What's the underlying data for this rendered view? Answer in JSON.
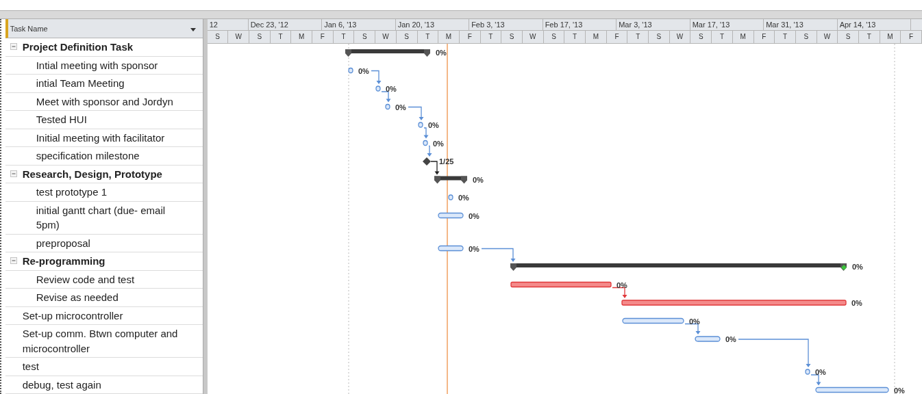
{
  "table": {
    "header": "Task Name",
    "rows": [
      {
        "name": "Project Definition Task",
        "expanded": true,
        "deadline": false,
        "bar": {
          "kind": "summary",
          "label": "0%"
        },
        "children": [
          {
            "name": "Intial meeting with sponsor",
            "deadline": false,
            "bar": {
              "kind": "task",
              "label": "0%"
            }
          },
          {
            "name": "intial Team Meeting",
            "deadline": false,
            "bar": {
              "kind": "task",
              "label": "0%"
            }
          },
          {
            "name": "Meet with sponsor and Jordyn",
            "deadline": false,
            "bar": {
              "kind": "task",
              "label": "0%"
            }
          },
          {
            "name": "Tested HUI",
            "deadline": false,
            "bar": {
              "kind": "task",
              "label": "0%"
            }
          },
          {
            "name": "Initial meeting with facilitator",
            "deadline": false,
            "bar": {
              "kind": "task",
              "label": "0%"
            }
          },
          {
            "name": "specification milestone",
            "deadline": false,
            "bar": {
              "kind": "milestone",
              "label": "1/25"
            }
          }
        ]
      },
      {
        "name": "Research, Design, Prototype",
        "expanded": true,
        "deadline": false,
        "bar": {
          "kind": "summary",
          "label": "0%"
        },
        "children": [
          {
            "name": "test prototype 1",
            "deadline": false,
            "bar": {
              "kind": "task",
              "label": "0%"
            }
          },
          {
            "name": "initial gantt chart (due- email 5pm)",
            "deadline": false,
            "bar": {
              "kind": "task",
              "label": "0%"
            }
          },
          {
            "name": "preproposal",
            "deadline": false,
            "bar": {
              "kind": "task",
              "label": "0%"
            }
          }
        ]
      },
      {
        "name": "Re-programming",
        "expanded": true,
        "deadline": true,
        "bar": {
          "kind": "summary",
          "label": "0%"
        },
        "children": [
          {
            "name": "Review code and test",
            "deadline": false,
            "bar": {
              "kind": "critical",
              "label": "0%"
            }
          },
          {
            "name": "Revise as needed",
            "deadline": false,
            "bar": {
              "kind": "critical",
              "label": "0%"
            }
          }
        ]
      },
      {
        "name": "Set-up microcontroller",
        "deadline": false,
        "bar": {
          "kind": "task",
          "label": "0%"
        }
      },
      {
        "name": "Set-up comm. Btwn computer and microcontroller",
        "deadline": false,
        "bar": {
          "kind": "task",
          "label": "0%"
        }
      },
      {
        "name": "test",
        "deadline": false,
        "bar": {
          "kind": "task",
          "label": "0%"
        }
      },
      {
        "name": "debug, test again",
        "deadline": false,
        "bar": {
          "kind": "task",
          "label": "0%"
        }
      }
    ]
  },
  "timescale": {
    "periods": [
      "12",
      "Dec 23, '12",
      "Jan 6, '13",
      "Jan 20, '13",
      "Feb 3, '13",
      "Feb 17, '13",
      "Mar 3, '13",
      "Mar 17, '13",
      "Mar 31, '13",
      "Apr 14, '13"
    ],
    "days": [
      "S",
      "W",
      "S",
      "T",
      "M",
      "F",
      "T",
      "S",
      "W",
      "S",
      "T",
      "M",
      "F",
      "T",
      "S",
      "W",
      "S",
      "T",
      "M",
      "F",
      "T",
      "S",
      "W",
      "S",
      "T",
      "M",
      "F",
      "T",
      "S",
      "W",
      "S",
      "T",
      "M",
      "F"
    ]
  }
}
